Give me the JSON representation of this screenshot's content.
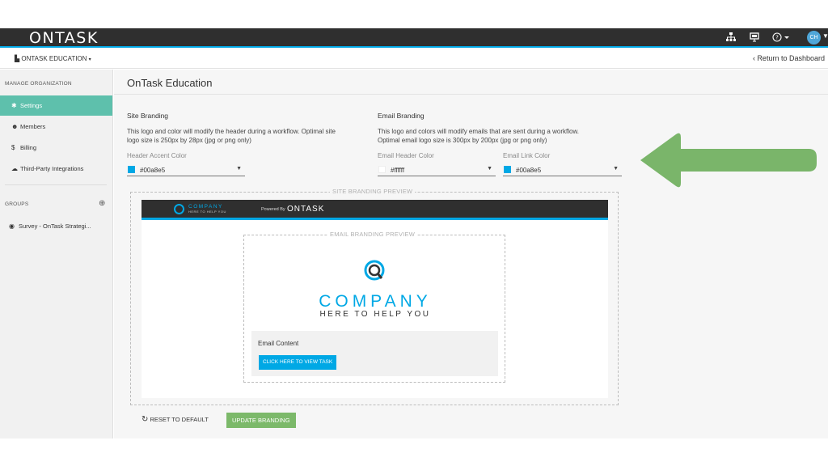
{
  "app": {
    "logo": "ONTASK",
    "org_switch": "ONTASK EDUCATION",
    "return_link": "Return to Dashboard",
    "avatar_initials": "CH"
  },
  "icons": {
    "org_chart": "sitemap-icon",
    "presentation": "presentation-icon",
    "help": "help-icon",
    "settings": "gear-icon",
    "members": "users-icon",
    "billing": "dollar-icon",
    "integrations": "cloud-icon",
    "add": "plus-circle-icon",
    "workflow": "workflow-icon",
    "reset": "refresh-icon",
    "arrow": "arrow-left-icon"
  },
  "sidebar": {
    "manage_heading": "MANAGE ORGANIZATION",
    "items": [
      {
        "label": "Settings",
        "icon": "✱",
        "active": true
      },
      {
        "label": "Members",
        "icon": "☻",
        "active": false
      },
      {
        "label": "Billing",
        "icon": "$",
        "active": false
      },
      {
        "label": "Third-Party Integrations",
        "icon": "☁",
        "active": false
      }
    ],
    "groups_heading": "GROUPS",
    "groups": [
      {
        "label": "Survey - OnTask Strategi...",
        "icon": "◉"
      }
    ]
  },
  "main": {
    "title": "OnTask Education",
    "site_branding": {
      "heading": "Site Branding",
      "description_line1": "This logo and color will modify the header during a workflow. Optimal site",
      "description_line2": "logo size is 250px by 28px (jpg or png only)",
      "header_accent_label": "Header Accent Color",
      "header_accent_value": "#00a8e5"
    },
    "email_branding": {
      "heading": "Email Branding",
      "description_line1": "This logo and colors will modify emails that are sent during a workflow.",
      "description_line2": "Optimal email logo size is 300px by 200px (jpg or png only)",
      "header_color_label": "Email Header Color",
      "header_color_value": "#ffffff",
      "link_color_label": "Email Link Color",
      "link_color_value": "#00a8e5"
    },
    "site_preview": {
      "legend": "SITE BRANDING PREVIEW",
      "company_logo": "COMPANY",
      "company_tagline": "HERE TO HELP YOU",
      "powered_by": "Powered By",
      "powered_logo": "ONTASK"
    },
    "email_preview": {
      "legend": "EMAIL BRANDING PREVIEW",
      "company": "COMPANY",
      "tagline": "HERE TO HELP YOU",
      "content_label": "Email Content",
      "cta_label": "CLICK HERE TO VIEW TASK"
    },
    "actions": {
      "reset_label": "RESET TO DEFAULT",
      "update_label": "UPDATE BRANDING"
    }
  },
  "colors": {
    "accent": "#00a8e5",
    "sidebar_active": "#5ec0ac",
    "update_button": "#7cb96a",
    "arrow": "#7ab56a",
    "topbar": "#2f2f2f"
  }
}
